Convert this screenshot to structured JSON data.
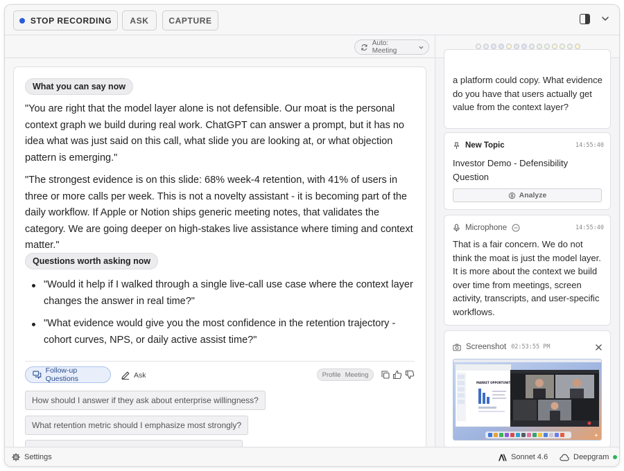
{
  "toolbar": {
    "stop_recording_label": "STOP RECORDING",
    "ask_label": "ASK",
    "capture_label": "CAPTURE",
    "record_dot_color": "#2c5cdb"
  },
  "main": {
    "mode_selector": "Auto: Meeting",
    "section1_title": "What you can say now",
    "paragraph1": "\"You are right that the model layer alone is not defensible. Our moat is the personal context graph we build during real work. ChatGPT can answer a prompt, but it has no idea what was just said on this call, what slide you are looking at, or what objection pattern is emerging.\"",
    "paragraph2": "\"The strongest evidence is on this slide: 68% week-4 retention, with 41% of users in three or more calls per week. This is not a novelty assistant - it is becoming part of the daily workflow. If Apple or Notion ships generic meeting notes, that validates the category. We are going deeper on high-stakes live assistance where timing and context matter.\"",
    "section2_title": "Questions worth asking now",
    "questions": [
      "\"Would it help if I walked through a single live-call use case where the context layer changes the answer in real time?\"",
      "\"What evidence would give you the most confidence in the retention trajectory - cohort curves, NPS, or daily active assist time?\""
    ],
    "followup_button": "Follow-up Questions",
    "ask_link": "Ask",
    "profile_label": "Profile",
    "profile_value": "Meeting",
    "suggestions": [
      "How should I answer if they ask about enterprise willingness?",
      "What retention metric should I emphasize most strongly?"
    ]
  },
  "right": {
    "dot_colors": [
      "#eef5ea",
      "#e8ecf2",
      "#e2e8f3",
      "#dde5f4",
      "#fbf5d9",
      "#e2e8f4",
      "#dde5f3",
      "#e8ecf2",
      "#e6f3e4",
      "#ecf5e6",
      "#fbf6d8",
      "#f3f7dc",
      "#e9f4e4",
      "#fbf5d6"
    ],
    "card1_text": "a platform could copy. What evidence do you have that users actually get value from the context layer?",
    "topic_label": "New Topic",
    "topic_time": "14:55:40",
    "topic_text": "Investor Demo - Defensibility Question",
    "analyze_label": "Analyze",
    "mic_label": "Microphone",
    "mic_time": "14:55:40",
    "mic_text": "That is a fair concern. We do not think the moat is just the model layer. It is more about the context we build over time from meetings, screen activity, transcripts, and user-specific workflows.",
    "screenshot_label": "Screenshot",
    "screenshot_time": "02:53:55 PM",
    "thumbnail": {
      "doc_heading": "MARKET OPPORTUNITY & TRACTION"
    }
  },
  "status": {
    "settings_label": "Settings",
    "model_label": "Sonnet 4.6",
    "transcriber_label": "Deepgram",
    "transcriber_status_color": "#2bb55a"
  }
}
